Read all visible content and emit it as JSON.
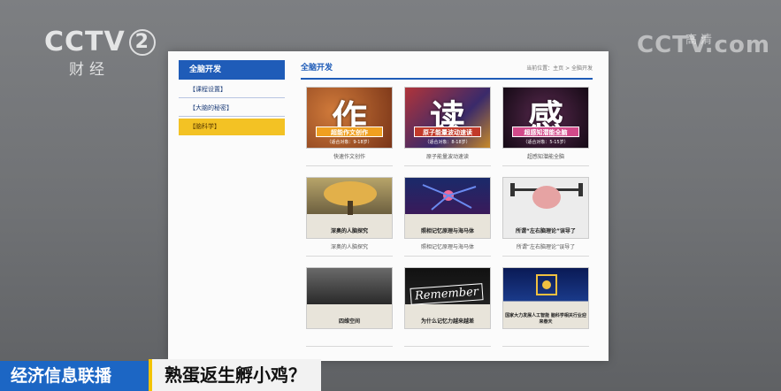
{
  "overlay": {
    "channel_logo": "CCTV",
    "channel_number": "2",
    "channel_sub": "财经",
    "hd_logo": "CCTV.com",
    "hd_badge": "高清",
    "program_name": "经济信息联播",
    "headline": "熟蛋返生孵小鸡？"
  },
  "sidebar": {
    "title": "全脑开发",
    "items": [
      {
        "label": "【课程设置】"
      },
      {
        "label": "【大脑的秘密】"
      },
      {
        "label": "【脑科学】"
      }
    ]
  },
  "main": {
    "title": "全脑开发",
    "breadcrumb": "当前位置：主页 > 全脑开发"
  },
  "cards": [
    {
      "big_char": "作",
      "banner": "超能作文创作",
      "note": "（适合对象：9-18岁）",
      "title": "快速作文创作",
      "bg": "#a0552a"
    },
    {
      "big_char": "读",
      "banner": "原子能量波动速读",
      "note": "（适合对象：8-18岁）",
      "title": "原子能量波动速读",
      "bg": "#7a2a3a"
    },
    {
      "big_char": "感",
      "banner": "超感知潜能全脑",
      "note": "（适合对象：5-15岁）",
      "title": "超感知潜能全脑",
      "bg": "#2a1a28"
    },
    {
      "caption": "深奥的人脑探究",
      "title": "深奥的人脑探究",
      "bg": "#8a7a4a"
    },
    {
      "caption": "照相记忆原理与海马体",
      "title": "照相记忆原理与海马体",
      "bg": "#1a2a5a"
    },
    {
      "caption": "所谓“左右脑理论”误导了",
      "title": "所谓“左右脑理论”误导了",
      "bg": "#e6e6e6"
    },
    {
      "caption": "四维空间",
      "title": "",
      "bg": "#3a3a3a"
    },
    {
      "remember": "Remember",
      "caption": "为什么记忆力越来越差",
      "title": "",
      "bg": "#111111"
    },
    {
      "caption": "国家大力发展人工智能 脑科学相关行业迎来春天",
      "title": "",
      "bg": "#0a1a44"
    }
  ]
}
